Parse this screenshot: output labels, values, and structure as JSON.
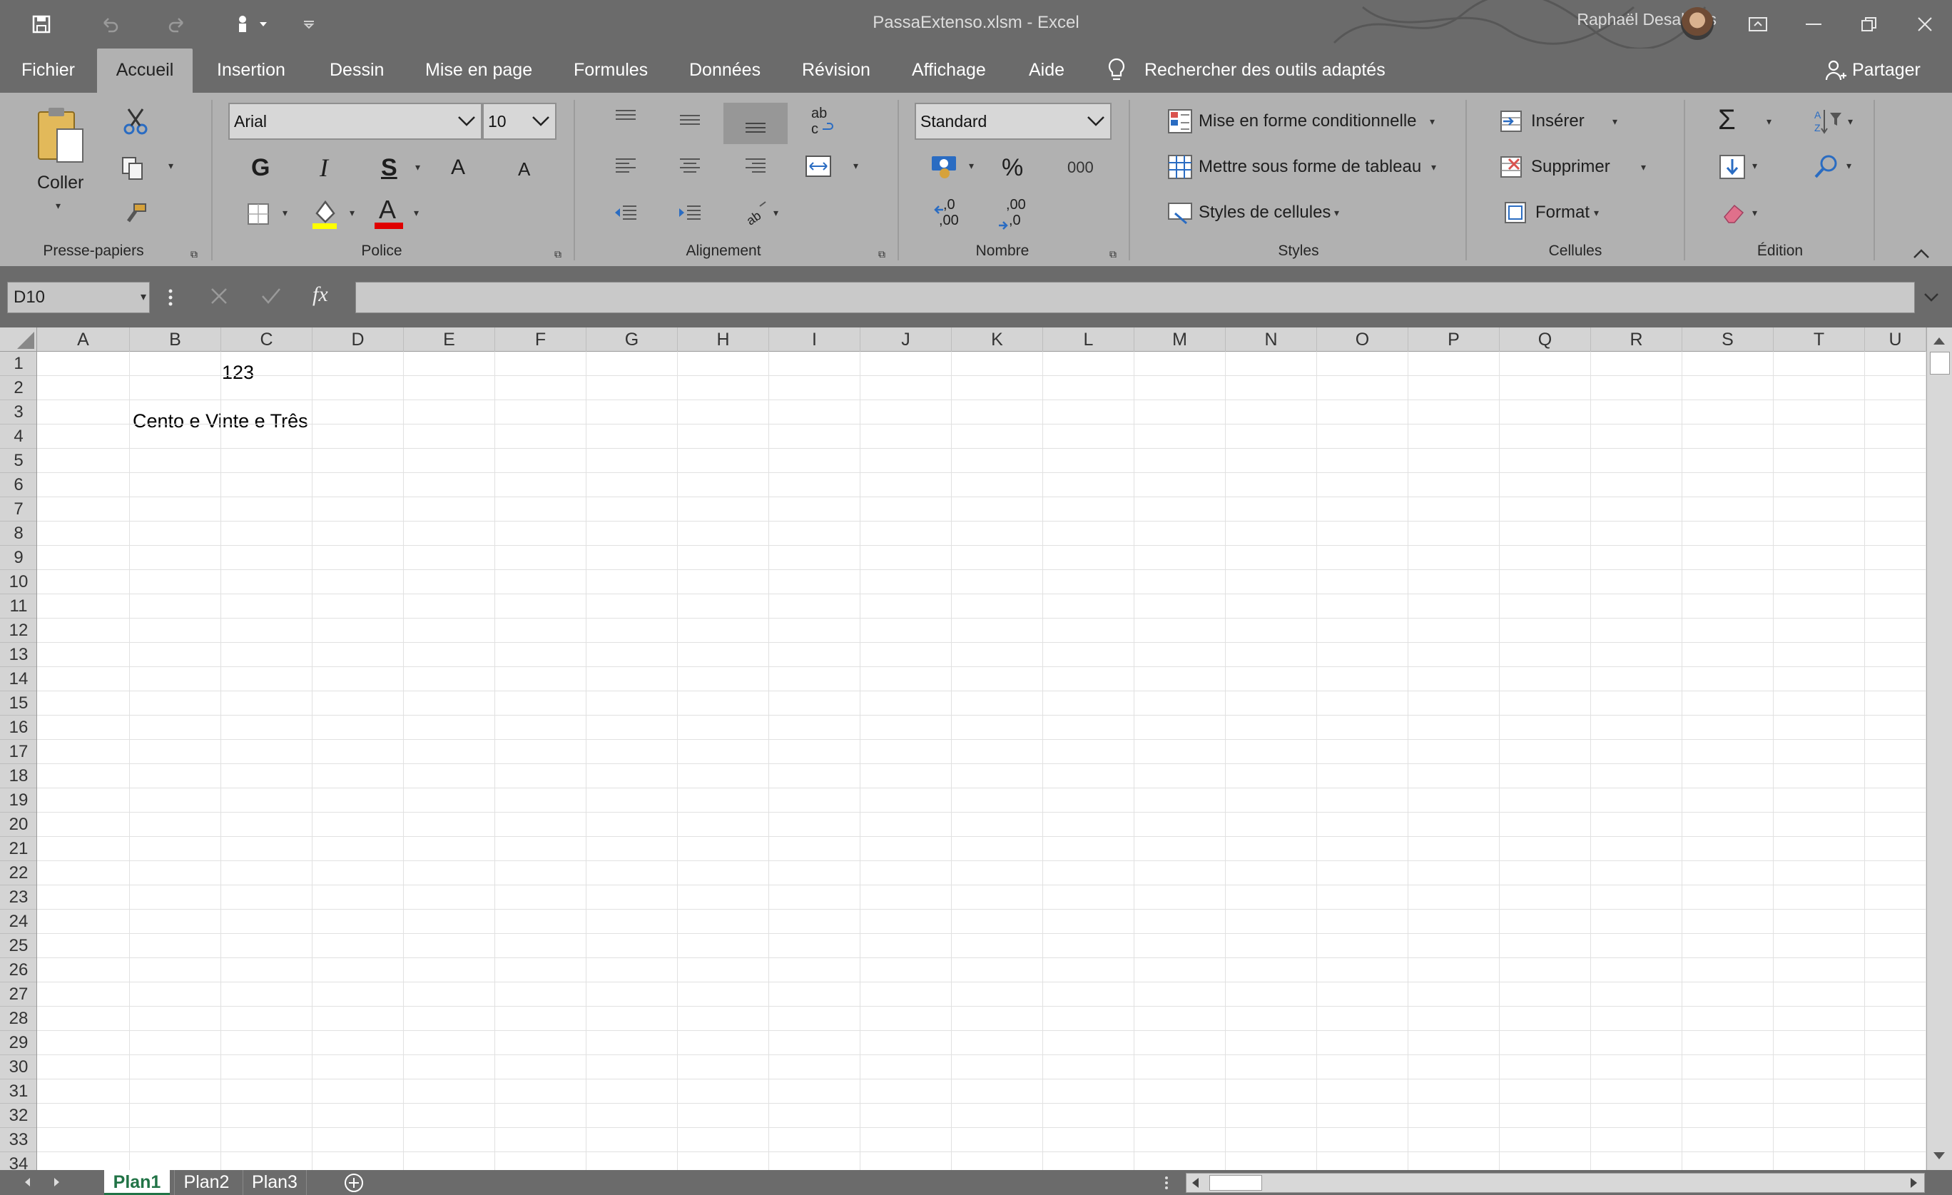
{
  "window": {
    "title": "PassaExtenso.xlsm  -  Excel",
    "user": "Raphaël Desalbres"
  },
  "menu": {
    "tabs": [
      "Fichier",
      "Accueil",
      "Insertion",
      "Dessin",
      "Mise en page",
      "Formules",
      "Données",
      "Révision",
      "Affichage",
      "Aide"
    ],
    "active": "Accueil",
    "search": "Rechercher des outils adaptés",
    "share": "Partager"
  },
  "ribbon": {
    "clipboard": {
      "label": "Presse-papiers",
      "paste": "Coller"
    },
    "font": {
      "label": "Police",
      "name": "Arial",
      "size": "10",
      "bold": "G",
      "italic": "I",
      "underline": "S",
      "grow": "A",
      "shrink": "A",
      "color_glyph": "A",
      "fill_color": "#ffff00",
      "font_color": "#e00000"
    },
    "alignment": {
      "label": "Alignement",
      "wrap_glyph": "ab"
    },
    "number": {
      "label": "Nombre",
      "format": "Standard",
      "percent": "%",
      "thousands": "000",
      "inc_dec": ",0",
      "inc_dec2": ",00",
      "dec_dec": ",00",
      "dec_dec2": ",0"
    },
    "styles": {
      "label": "Styles",
      "conditional": "Mise en forme conditionnelle",
      "as_table": "Mettre sous forme de tableau",
      "cell_styles": "Styles de cellules"
    },
    "cells": {
      "label": "Cellules",
      "insert": "Insérer",
      "delete": "Supprimer",
      "format": "Format"
    },
    "editing": {
      "label": "Édition",
      "sum": "Σ"
    }
  },
  "formula_bar": {
    "name_box": "D10",
    "fx": "fx",
    "value": ""
  },
  "grid": {
    "columns": [
      "A",
      "B",
      "C",
      "D",
      "E",
      "F",
      "G",
      "H",
      "I",
      "J",
      "K",
      "L",
      "M",
      "N",
      "O",
      "P",
      "Q",
      "R",
      "S",
      "T",
      "U"
    ],
    "rows": [
      "1",
      "2",
      "3",
      "4",
      "5",
      "6",
      "7",
      "8",
      "9",
      "10",
      "11",
      "12",
      "13",
      "14",
      "15",
      "16",
      "17",
      "18",
      "19",
      "20",
      "21",
      "22",
      "23",
      "24",
      "25",
      "26",
      "27",
      "28",
      "29",
      "30",
      "31",
      "32",
      "33",
      "34"
    ],
    "cells": {
      "B2": "123",
      "B4": "Cento e  Vinte e  Três"
    }
  },
  "sheets": {
    "tabs": [
      "Plan1",
      "Plan2",
      "Plan3"
    ],
    "active": "Plan1"
  }
}
